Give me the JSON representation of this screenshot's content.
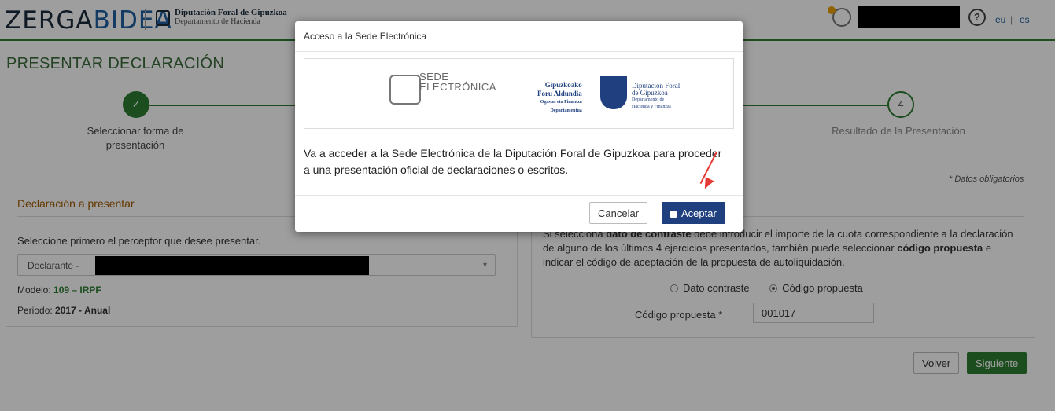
{
  "header": {
    "logo_part1": "ZERGA",
    "logo_part2": "BIDEA",
    "dipu_name": "Diputación Foral de Gipuzkoa",
    "dipu_dept": "Departamento de Hacienda",
    "lang_eu": "eu",
    "lang_sep": "|",
    "lang_es": "es",
    "help": "?"
  },
  "page": {
    "title": "PRESENTAR DECLARACIÓN",
    "required_note": "* Datos obligatorios"
  },
  "stepper": {
    "step1_label": "Seleccionar forma de presentación",
    "step4_number": "4",
    "step4_label": "Resultado de la Presentación",
    "step1_check": "✓"
  },
  "left_panel": {
    "title": "Declaración a presentar",
    "prompt": "Seleccione primero el perceptor que desee presentar.",
    "select_value": "Declarante -",
    "modelo_label": "Modelo: ",
    "modelo_value": "109",
    "modelo_sep": " – ",
    "modelo_name": "IRPF",
    "periodo_label": "Periodo: ",
    "periodo_value": "2017 - Anual"
  },
  "right_panel": {
    "text_start": "Si selecciona ",
    "text_bold1": "dato de contraste",
    "text_mid": " debe introducir el importe de la cuota correspondiente a la declaración de alguno de los últimos 4 ejercicios presentados, también puede seleccionar ",
    "text_bold2": "código propuesta",
    "text_end": " e indicar el código de aceptación de la propuesta de autoliquidación.",
    "radio1": "Dato contraste",
    "radio2": "Código propuesta",
    "code_label": "Código propuesta *",
    "code_value": "001017"
  },
  "buttons": {
    "back": "Volver",
    "next": "Siguiente"
  },
  "modal": {
    "title": "Acceso a la Sede Electrónica",
    "sede_line1": "SEDE",
    "sede_line2": "ELECTRÓNICA",
    "gip_line1": "Gipuzkoako",
    "gip_line2": "Foru Aldundia",
    "gip_line3": "Ogasun eta Finantza",
    "gip_line4": "Departamentua",
    "dfg_line1": "Diputación Foral",
    "dfg_line2": "de Gipuzkoa",
    "dfg_line3": "Departamento de",
    "dfg_line4": "Hacienda y Finanzas",
    "body": "Va a acceder a la Sede Electrónica de la Diputación Foral de Gipuzkoa para proceder a una presentación oficial de declaraciones o escritos.",
    "cancel": "Cancelar",
    "accept": "Aceptar"
  },
  "colors": {
    "brand_green": "#2e7d32",
    "brand_blue": "#1f3f7f",
    "arrow_red": "#e53935"
  }
}
